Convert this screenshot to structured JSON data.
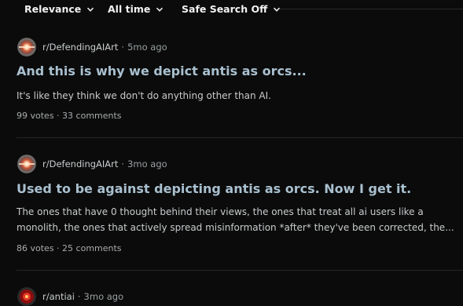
{
  "filters": [
    {
      "label": "Relevance",
      "icon": "chevron-down-icon"
    },
    {
      "label": "All time",
      "icon": "chevron-down-icon"
    },
    {
      "label": "Safe Search Off",
      "icon": "chevron-down-icon"
    }
  ],
  "posts": [
    {
      "subreddit": "r/DefendingAIArt",
      "separator": "·",
      "age": "5mo ago",
      "title": "And this is why we depict antis as orcs...",
      "body_lines": [
        "It's like they think we don't do anything other than AI."
      ],
      "votes": "99 votes",
      "stats_separator": "·",
      "comments": "33 comments"
    },
    {
      "subreddit": "r/DefendingAIArt",
      "separator": "·",
      "age": "3mo ago",
      "title": "Used to be against depicting antis as orcs. Now I get it.",
      "body_lines": [
        "The ones that have 0 thought behind their views, the ones that treat all ai users like a",
        "monolith, the ones that actively spread misinformation *after* they've been corrected, the..."
      ],
      "votes": "86 votes",
      "stats_separator": "·",
      "comments": "25 comments"
    },
    {
      "subreddit": "r/antiai",
      "separator": "·",
      "age": "3mo ago"
    }
  ]
}
